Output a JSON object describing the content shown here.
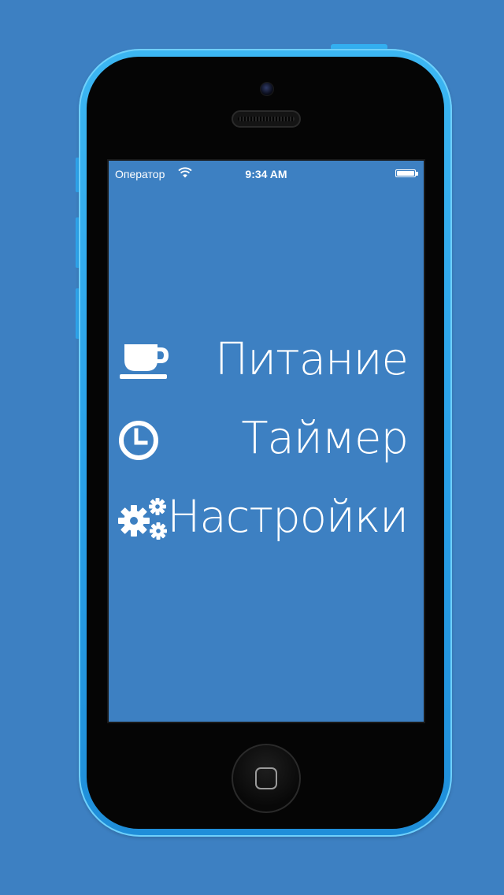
{
  "status_bar": {
    "carrier": "Оператор",
    "time": "9:34 AM",
    "wifi_icon": "wifi-icon",
    "battery_icon": "battery-icon"
  },
  "menu": {
    "items": [
      {
        "label": "Питание",
        "icon": "coffee-cup-icon"
      },
      {
        "label": "Таймер",
        "icon": "clock-icon"
      },
      {
        "label": "Настройки",
        "icon": "gears-icon"
      }
    ]
  },
  "colors": {
    "background": "#3d80c2",
    "phone_body": "#2aa2ea",
    "text": "#ffffff"
  }
}
